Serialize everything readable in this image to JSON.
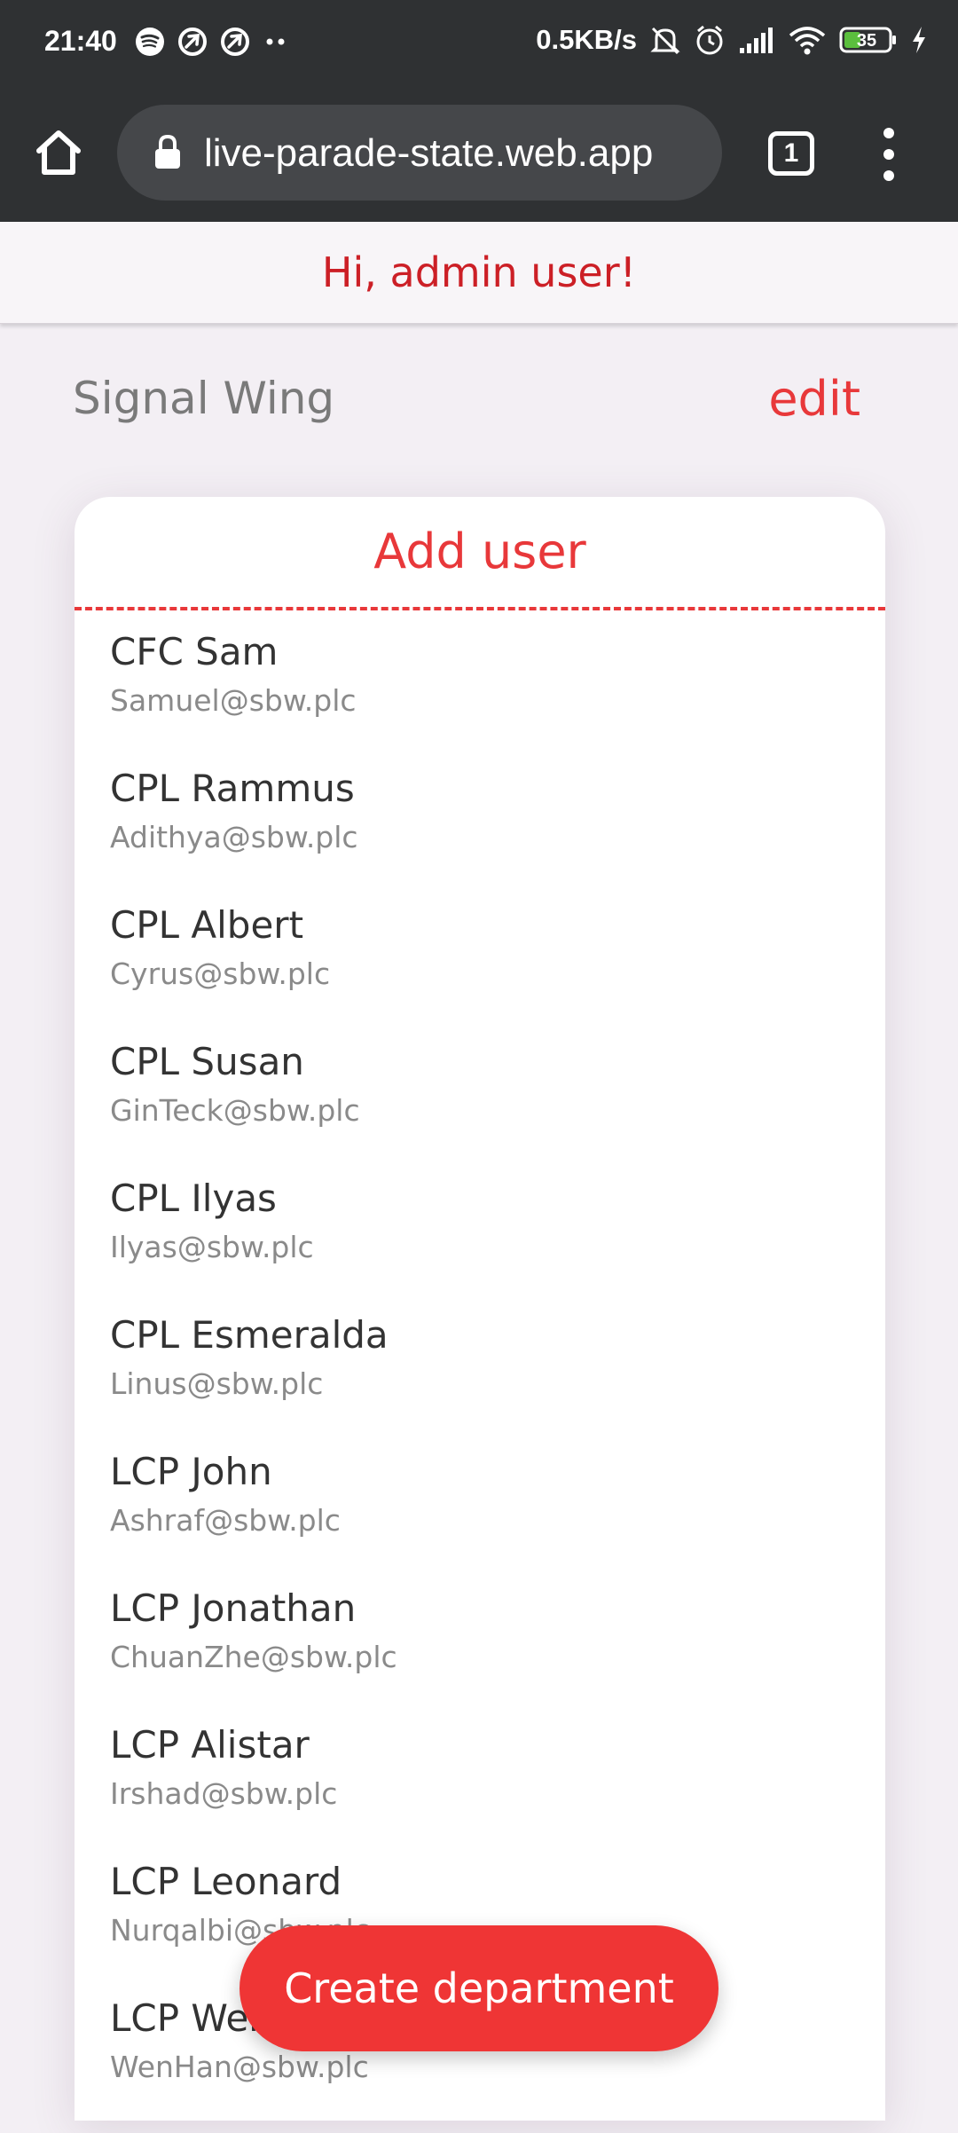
{
  "status_bar": {
    "time": "21:40",
    "left_icons": [
      "spotify-icon",
      "vpn-icon",
      "vpn-icon",
      "more-notifications-icon"
    ],
    "net_speed": "0.5KB/s",
    "battery": "35",
    "right_icons": [
      "mute-icon",
      "alarm-icon",
      "signal-icon",
      "wifi-icon",
      "battery-icon",
      "charging-icon"
    ]
  },
  "browser": {
    "url": "live-parade-state.web.app",
    "tab_count": "1"
  },
  "header": {
    "greeting": "Hi, admin user!"
  },
  "department": {
    "name": "Signal Wing",
    "edit_label": "edit"
  },
  "card": {
    "add_user_label": "Add user",
    "users": [
      {
        "name": "CFC Sam",
        "email": "Samuel@sbw.plc"
      },
      {
        "name": "CPL Rammus",
        "email": "Adithya@sbw.plc"
      },
      {
        "name": "CPL Albert",
        "email": "Cyrus@sbw.plc"
      },
      {
        "name": "CPL Susan",
        "email": "GinTeck@sbw.plc"
      },
      {
        "name": "CPL Ilyas",
        "email": "Ilyas@sbw.plc"
      },
      {
        "name": "CPL Esmeralda",
        "email": "Linus@sbw.plc"
      },
      {
        "name": "LCP John",
        "email": "Ashraf@sbw.plc"
      },
      {
        "name": "LCP Jonathan",
        "email": "ChuanZhe@sbw.plc"
      },
      {
        "name": "LCP Alistar",
        "email": "Irshad@sbw.plc"
      },
      {
        "name": "LCP Leonard",
        "email": "Nurqalbi@sbw.plc"
      },
      {
        "name": "LCP WenHan",
        "email": "WenHan@sbw.plc"
      }
    ]
  },
  "fab": {
    "label": "Create department"
  },
  "colors": {
    "accent": "#e8383a",
    "greeting": "#cc1f26",
    "chrome": "#2f3133",
    "background": "#f3eff4"
  }
}
